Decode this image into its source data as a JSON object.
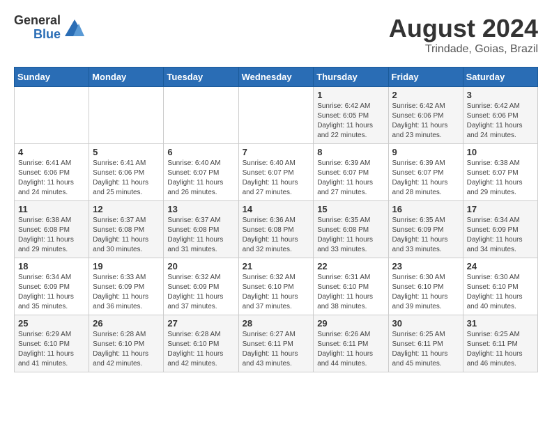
{
  "header": {
    "logo_general": "General",
    "logo_blue": "Blue",
    "month_title": "August 2024",
    "location": "Trindade, Goias, Brazil"
  },
  "days_of_week": [
    "Sunday",
    "Monday",
    "Tuesday",
    "Wednesday",
    "Thursday",
    "Friday",
    "Saturday"
  ],
  "weeks": [
    [
      {
        "day": "",
        "info": ""
      },
      {
        "day": "",
        "info": ""
      },
      {
        "day": "",
        "info": ""
      },
      {
        "day": "",
        "info": ""
      },
      {
        "day": "1",
        "info": "Sunrise: 6:42 AM\nSunset: 6:05 PM\nDaylight: 11 hours and 22 minutes."
      },
      {
        "day": "2",
        "info": "Sunrise: 6:42 AM\nSunset: 6:06 PM\nDaylight: 11 hours and 23 minutes."
      },
      {
        "day": "3",
        "info": "Sunrise: 6:42 AM\nSunset: 6:06 PM\nDaylight: 11 hours and 24 minutes."
      }
    ],
    [
      {
        "day": "4",
        "info": "Sunrise: 6:41 AM\nSunset: 6:06 PM\nDaylight: 11 hours and 24 minutes."
      },
      {
        "day": "5",
        "info": "Sunrise: 6:41 AM\nSunset: 6:06 PM\nDaylight: 11 hours and 25 minutes."
      },
      {
        "day": "6",
        "info": "Sunrise: 6:40 AM\nSunset: 6:07 PM\nDaylight: 11 hours and 26 minutes."
      },
      {
        "day": "7",
        "info": "Sunrise: 6:40 AM\nSunset: 6:07 PM\nDaylight: 11 hours and 27 minutes."
      },
      {
        "day": "8",
        "info": "Sunrise: 6:39 AM\nSunset: 6:07 PM\nDaylight: 11 hours and 27 minutes."
      },
      {
        "day": "9",
        "info": "Sunrise: 6:39 AM\nSunset: 6:07 PM\nDaylight: 11 hours and 28 minutes."
      },
      {
        "day": "10",
        "info": "Sunrise: 6:38 AM\nSunset: 6:07 PM\nDaylight: 11 hours and 29 minutes."
      }
    ],
    [
      {
        "day": "11",
        "info": "Sunrise: 6:38 AM\nSunset: 6:08 PM\nDaylight: 11 hours and 29 minutes."
      },
      {
        "day": "12",
        "info": "Sunrise: 6:37 AM\nSunset: 6:08 PM\nDaylight: 11 hours and 30 minutes."
      },
      {
        "day": "13",
        "info": "Sunrise: 6:37 AM\nSunset: 6:08 PM\nDaylight: 11 hours and 31 minutes."
      },
      {
        "day": "14",
        "info": "Sunrise: 6:36 AM\nSunset: 6:08 PM\nDaylight: 11 hours and 32 minutes."
      },
      {
        "day": "15",
        "info": "Sunrise: 6:35 AM\nSunset: 6:08 PM\nDaylight: 11 hours and 33 minutes."
      },
      {
        "day": "16",
        "info": "Sunrise: 6:35 AM\nSunset: 6:09 PM\nDaylight: 11 hours and 33 minutes."
      },
      {
        "day": "17",
        "info": "Sunrise: 6:34 AM\nSunset: 6:09 PM\nDaylight: 11 hours and 34 minutes."
      }
    ],
    [
      {
        "day": "18",
        "info": "Sunrise: 6:34 AM\nSunset: 6:09 PM\nDaylight: 11 hours and 35 minutes."
      },
      {
        "day": "19",
        "info": "Sunrise: 6:33 AM\nSunset: 6:09 PM\nDaylight: 11 hours and 36 minutes."
      },
      {
        "day": "20",
        "info": "Sunrise: 6:32 AM\nSunset: 6:09 PM\nDaylight: 11 hours and 37 minutes."
      },
      {
        "day": "21",
        "info": "Sunrise: 6:32 AM\nSunset: 6:10 PM\nDaylight: 11 hours and 37 minutes."
      },
      {
        "day": "22",
        "info": "Sunrise: 6:31 AM\nSunset: 6:10 PM\nDaylight: 11 hours and 38 minutes."
      },
      {
        "day": "23",
        "info": "Sunrise: 6:30 AM\nSunset: 6:10 PM\nDaylight: 11 hours and 39 minutes."
      },
      {
        "day": "24",
        "info": "Sunrise: 6:30 AM\nSunset: 6:10 PM\nDaylight: 11 hours and 40 minutes."
      }
    ],
    [
      {
        "day": "25",
        "info": "Sunrise: 6:29 AM\nSunset: 6:10 PM\nDaylight: 11 hours and 41 minutes."
      },
      {
        "day": "26",
        "info": "Sunrise: 6:28 AM\nSunset: 6:10 PM\nDaylight: 11 hours and 42 minutes."
      },
      {
        "day": "27",
        "info": "Sunrise: 6:28 AM\nSunset: 6:10 PM\nDaylight: 11 hours and 42 minutes."
      },
      {
        "day": "28",
        "info": "Sunrise: 6:27 AM\nSunset: 6:11 PM\nDaylight: 11 hours and 43 minutes."
      },
      {
        "day": "29",
        "info": "Sunrise: 6:26 AM\nSunset: 6:11 PM\nDaylight: 11 hours and 44 minutes."
      },
      {
        "day": "30",
        "info": "Sunrise: 6:25 AM\nSunset: 6:11 PM\nDaylight: 11 hours and 45 minutes."
      },
      {
        "day": "31",
        "info": "Sunrise: 6:25 AM\nSunset: 6:11 PM\nDaylight: 11 hours and 46 minutes."
      }
    ]
  ]
}
